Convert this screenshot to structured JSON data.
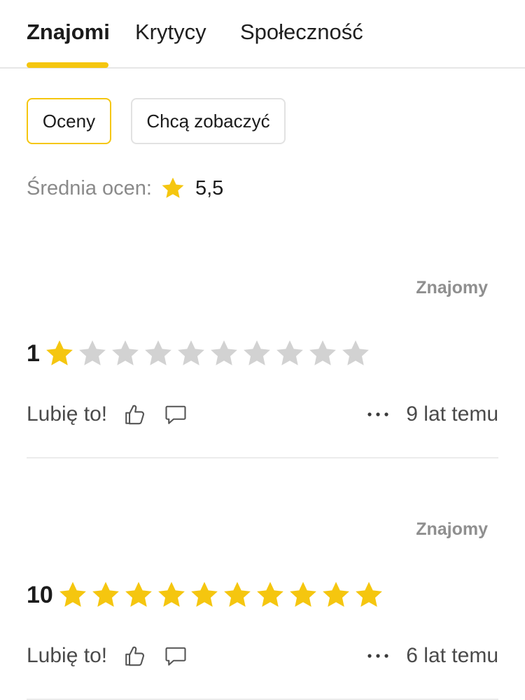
{
  "tabs": {
    "items": [
      {
        "label": "Znajomi"
      },
      {
        "label": "Krytycy"
      },
      {
        "label": "Społeczność"
      }
    ]
  },
  "filters": {
    "ratings": "Oceny",
    "want_to_see": "Chcą zobaczyć"
  },
  "average": {
    "label": "Średnia ocen:",
    "value": "5,5"
  },
  "reviews": [
    {
      "relation": "Znajomy",
      "rating": "1",
      "rating_value": 1,
      "max_stars": 10,
      "like_label": "Lubię to!",
      "time": "9 lat temu"
    },
    {
      "relation": "Znajomy",
      "rating": "10",
      "rating_value": 10,
      "max_stars": 10,
      "like_label": "Lubię to!",
      "time": "6 lat temu"
    }
  ],
  "colors": {
    "accent": "#f5c60f",
    "star_on": "#f5c60f",
    "star_off": "#d2d2d2",
    "muted_text": "#8a8a8a"
  },
  "icons": {
    "average": "star-icon",
    "like": "thumbs-up-icon",
    "comment": "comment-icon",
    "more": "more-dots-icon"
  }
}
